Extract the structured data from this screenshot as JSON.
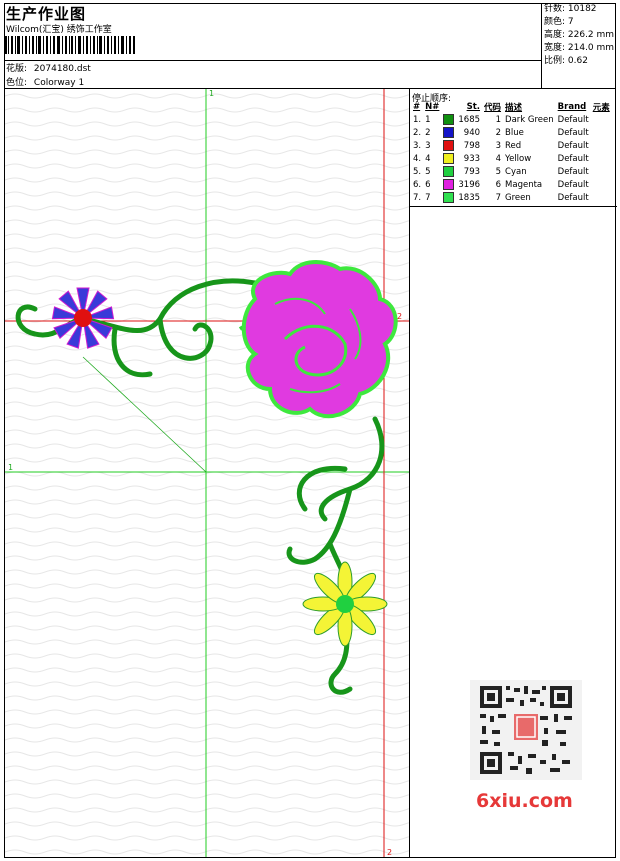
{
  "header": {
    "title": "生产作业图",
    "subtitle": "Wilcom(汇宝) 绣饰工作室",
    "design_label": "花版:",
    "design_value": "2074180.dst",
    "colorway_label": "色位:",
    "colorway_value": "Colorway 1"
  },
  "stats": {
    "stitches": "针数: 10182",
    "colors": "颜色: 7",
    "height": "高度: 226.2 mm",
    "width": "宽度: 214.0 mm",
    "scale": "比例: 0.62"
  },
  "color_table": {
    "title": "停止顺序:",
    "headers": [
      "#",
      "N#",
      "St.",
      "代码",
      "描述",
      "Brand",
      "元素"
    ],
    "rows": [
      {
        "idx": "1.",
        "n": "1",
        "color": "#109010",
        "st": "1685",
        "code": "1",
        "desc": "Dark Green",
        "brand": "Default"
      },
      {
        "idx": "2.",
        "n": "2",
        "color": "#1414c8",
        "st": "940",
        "code": "2",
        "desc": "Blue",
        "brand": "Default"
      },
      {
        "idx": "3.",
        "n": "3",
        "color": "#e01010",
        "st": "798",
        "code": "3",
        "desc": "Red",
        "brand": "Default"
      },
      {
        "idx": "4.",
        "n": "4",
        "color": "#f0f020",
        "st": "933",
        "code": "4",
        "desc": "Yellow",
        "brand": "Default"
      },
      {
        "idx": "5.",
        "n": "5",
        "color": "#20d040",
        "st": "793",
        "code": "5",
        "desc": "Cyan",
        "brand": "Default"
      },
      {
        "idx": "6.",
        "n": "6",
        "color": "#e020e0",
        "st": "3196",
        "code": "6",
        "desc": "Magenta",
        "brand": "Default"
      },
      {
        "idx": "7.",
        "n": "7",
        "color": "#30e050",
        "st": "1835",
        "code": "7",
        "desc": "Green",
        "brand": "Default"
      }
    ]
  },
  "axes": {
    "green_top": "1",
    "green_left": "1",
    "red_right": "2",
    "red_bottom": "2"
  },
  "watermark": "6xiu.com",
  "colors": {
    "guide_green": "#22cc22",
    "guide_red": "#dd1111"
  }
}
